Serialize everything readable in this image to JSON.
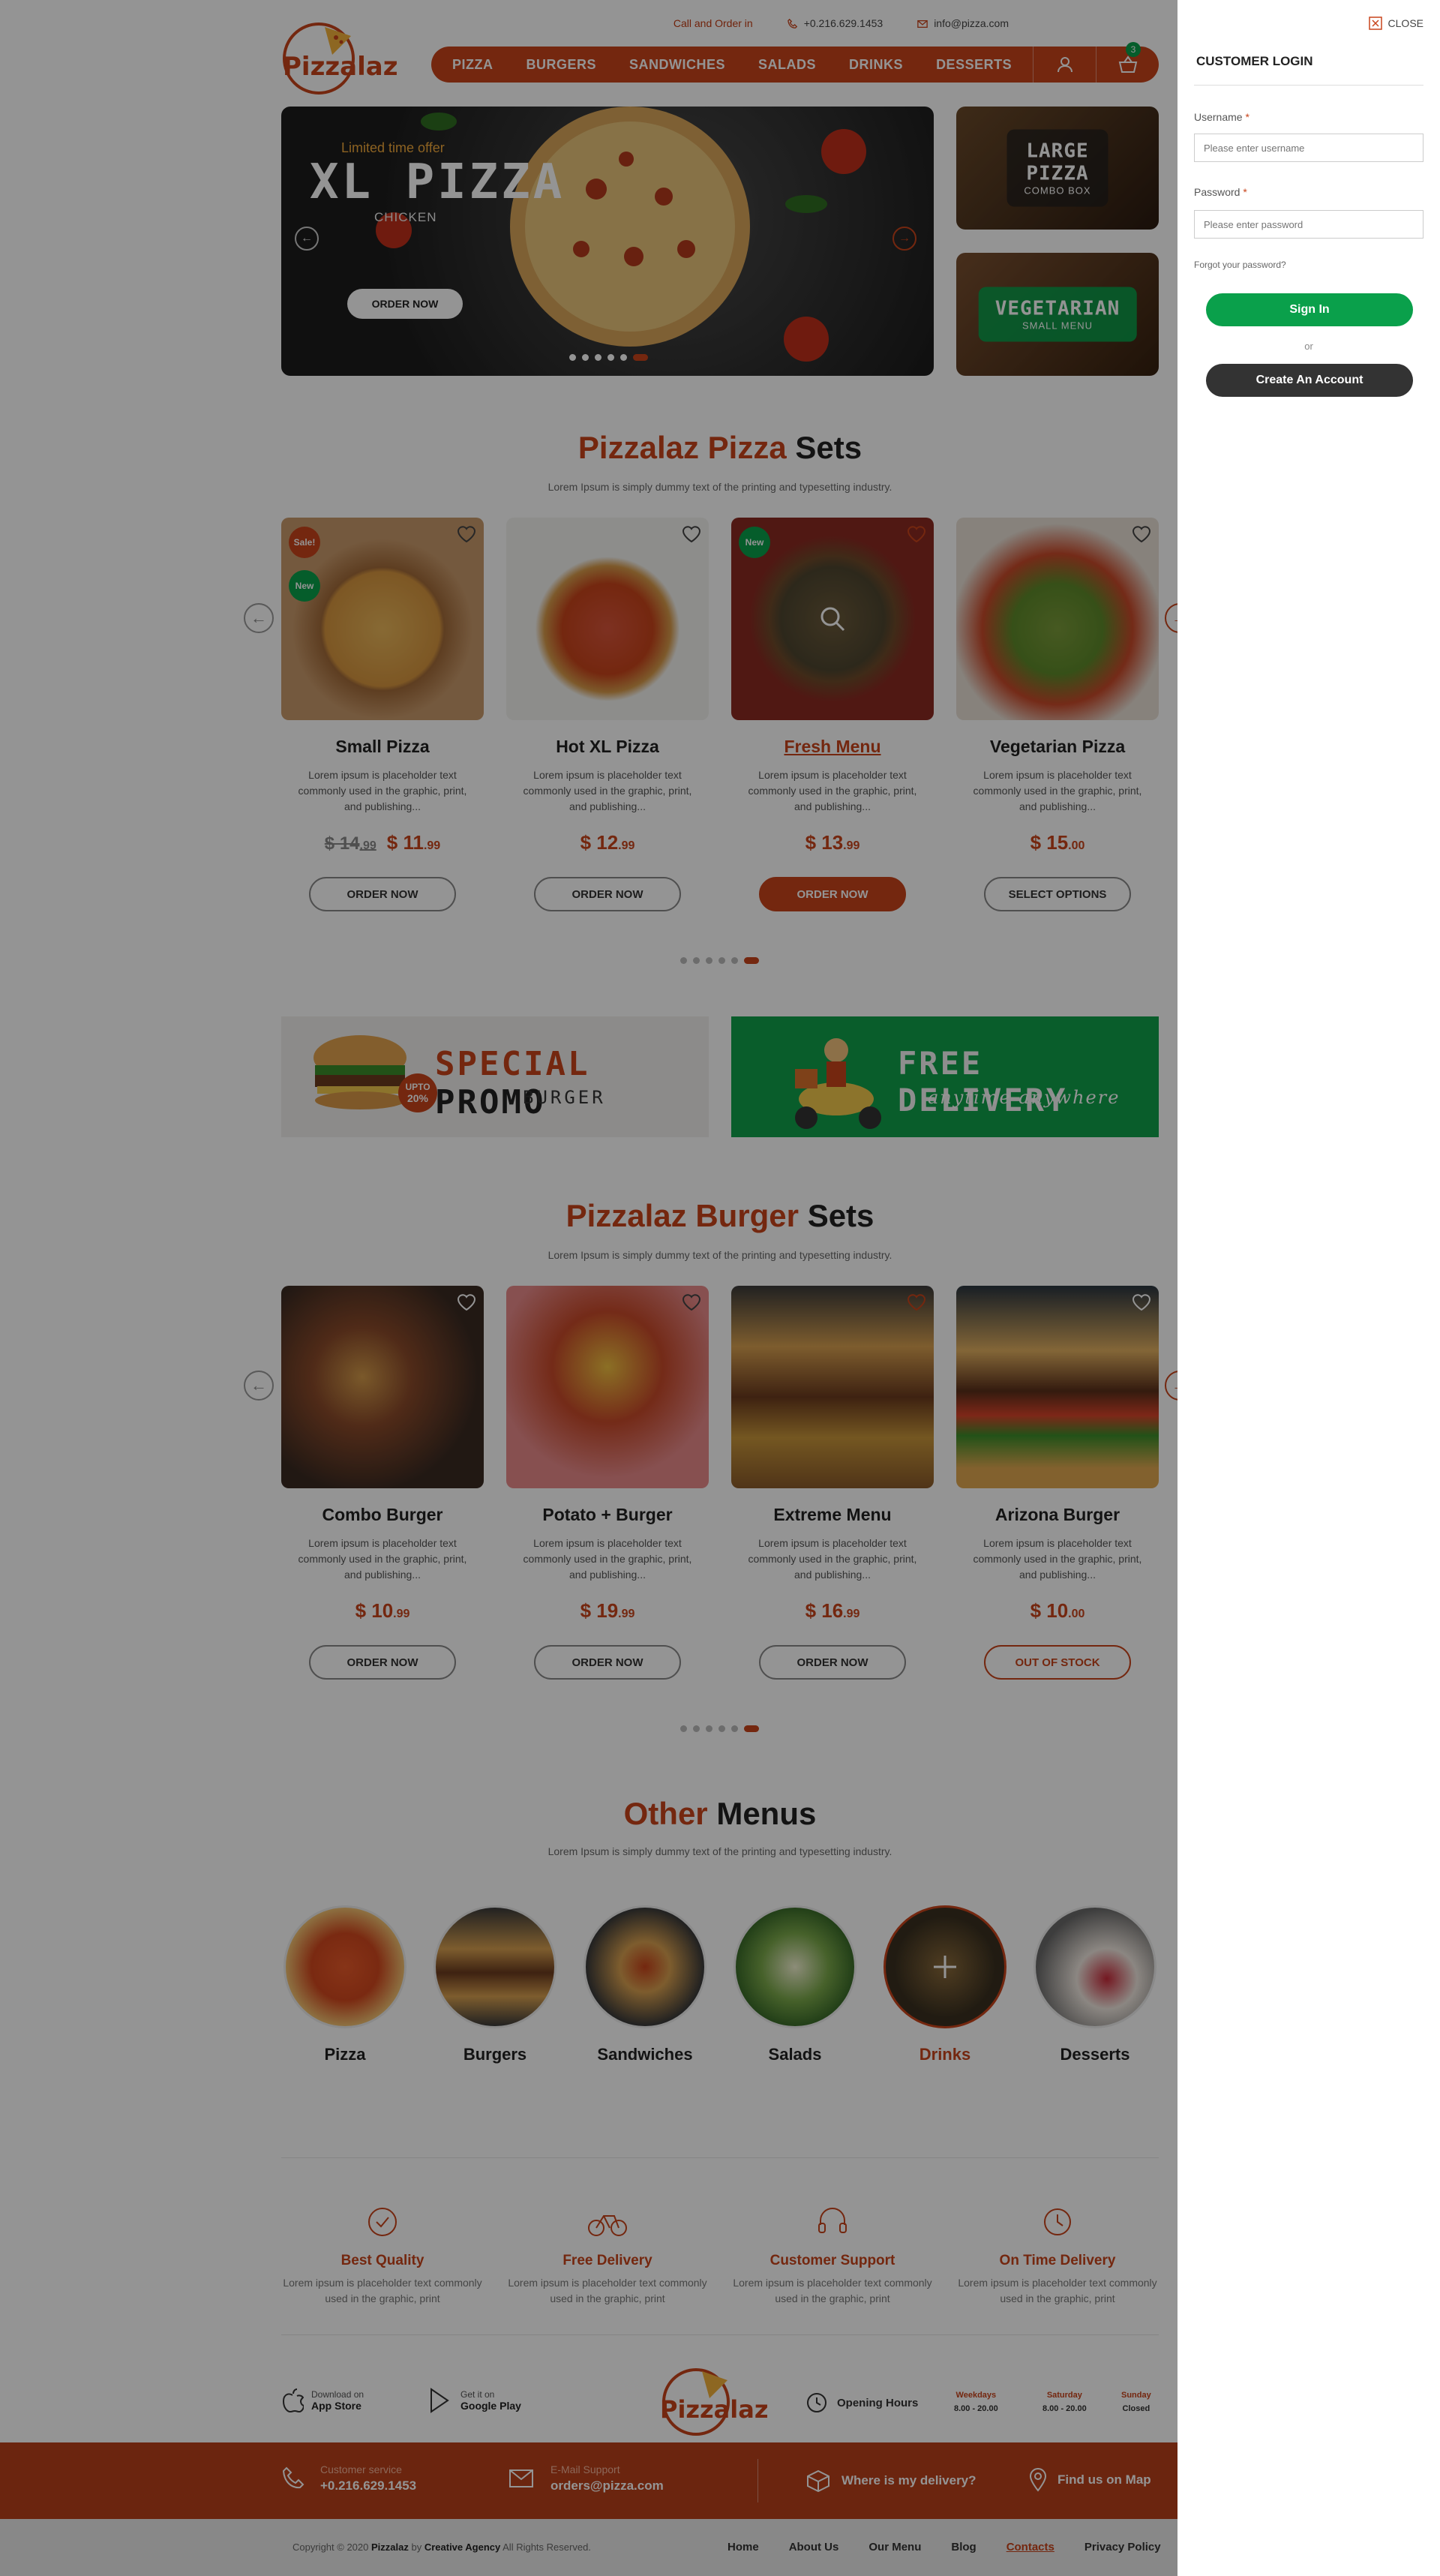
{
  "header": {
    "call_label": "Call and Order in",
    "phone": "+0.216.629.1453",
    "email": "info@pizza.com",
    "logo_text": "Pizzalaz",
    "nav": [
      "PIZZA",
      "BURGERS",
      "SANDWICHES",
      "SALADS",
      "DRINKS",
      "DESSERTS"
    ],
    "cart_count": "3"
  },
  "hero": {
    "tagline": "Limited time offer",
    "title": "XL PIZZA",
    "subtitle": "CHICKEN",
    "button": "ORDER NOW",
    "side1_title": "LARGE PIZZA",
    "side1_sub": "COMBO BOX",
    "side2_title": "VEGETARIAN",
    "side2_sub": "SMALL MENU"
  },
  "pizza_section": {
    "title_a": "Pizzalaz Pizza",
    "title_b": "Sets",
    "subtitle": "Lorem Ipsum is simply dummy text of the printing and typesetting industry.",
    "desc": "Lorem ipsum is placeholder text commonly used in the graphic, print, and publishing...",
    "items": [
      {
        "name": "Small Pizza",
        "old_int": "$ 14",
        "old_cents": ".99",
        "int": "$ 11",
        "cents": ".99",
        "button": "ORDER NOW",
        "badge1": "Sale!",
        "badge2": "New"
      },
      {
        "name": "Hot XL Pizza",
        "int": "$ 12",
        "cents": ".99",
        "button": "ORDER NOW"
      },
      {
        "name": "Fresh Menu",
        "int": "$ 13",
        "cents": ".99",
        "button": "ORDER NOW",
        "badge1": "New"
      },
      {
        "name": "Vegetarian Pizza",
        "int": "$ 15",
        "cents": ".00",
        "button": "SELECT OPTIONS"
      }
    ]
  },
  "promo": {
    "p1_upto": "UPTO",
    "p1_pct": "20%",
    "p1_a": "SPECIAL",
    "p1_b": "PROMO",
    "p1_c": "BURGER",
    "p2_a": "FREE DELIVERY",
    "p2_b": "anytime anywhere"
  },
  "burger_section": {
    "title_a": "Pizzalaz Burger",
    "title_b": "Sets",
    "subtitle": "Lorem Ipsum is simply dummy text of the printing and typesetting industry.",
    "desc": "Lorem ipsum is placeholder text commonly used in the graphic, print, and publishing...",
    "items": [
      {
        "name": "Combo Burger",
        "int": "$ 10",
        "cents": ".99",
        "button": "ORDER NOW"
      },
      {
        "name": "Potato + Burger",
        "int": "$ 19",
        "cents": ".99",
        "button": "ORDER NOW"
      },
      {
        "name": "Extreme Menu",
        "int": "$ 16",
        "cents": ".99",
        "button": "ORDER NOW"
      },
      {
        "name": "Arizona Burger",
        "int": "$ 10",
        "cents": ".00",
        "button": "OUT OF STOCK"
      }
    ]
  },
  "other_menus": {
    "title_a": "Other",
    "title_b": "Menus",
    "subtitle": "Lorem Ipsum is simply dummy text of the printing and typesetting industry.",
    "items": [
      "Pizza",
      "Burgers",
      "Sandwiches",
      "Salads",
      "Drinks",
      "Desserts"
    ]
  },
  "features": {
    "desc": "Lorem ipsum is placeholder text commonly used in the graphic, print",
    "items": [
      "Best Quality",
      "Free Delivery",
      "Customer Support",
      "On Time Delivery"
    ]
  },
  "footer": {
    "app1_small": "Download on",
    "app1_big": "App Store",
    "app2_small": "Get it on",
    "app2_big": "Google Play",
    "opening": "Opening Hours",
    "hours": [
      {
        "day": "Weekdays",
        "time": "8.00 - 20.00"
      },
      {
        "day": "Saturday",
        "time": "8.00 - 20.00"
      },
      {
        "day": "Sunday",
        "time": "Closed"
      }
    ],
    "cs_label": "Customer service",
    "cs_value": "+0.216.629.1453",
    "mail_label": "E-Mail Support",
    "mail_value": "orders@pizza.com",
    "where": "Where is my delivery?",
    "map": "Find us on Map",
    "copy_a": "Copyright © 2020",
    "copy_b": "Pizzalaz",
    "copy_c": "by",
    "copy_d": "Creative Agency",
    "copy_e": "All Rights Reserved.",
    "links": [
      "Home",
      "About Us",
      "Our Menu",
      "Blog",
      "Contacts",
      "Privacy Policy"
    ]
  },
  "login": {
    "close": "CLOSE",
    "title": "CUSTOMER LOGIN",
    "username_label": "Username",
    "username_placeholder": "Please enter username",
    "password_label": "Password",
    "password_placeholder": "Please enter password",
    "required": "*",
    "forgot": "Forgot your password?",
    "signin": "Sign In",
    "or": "or",
    "create": "Create An Account"
  },
  "colors": {
    "brand": "#c8441b",
    "green": "#0aa04b",
    "dark": "#333333"
  }
}
